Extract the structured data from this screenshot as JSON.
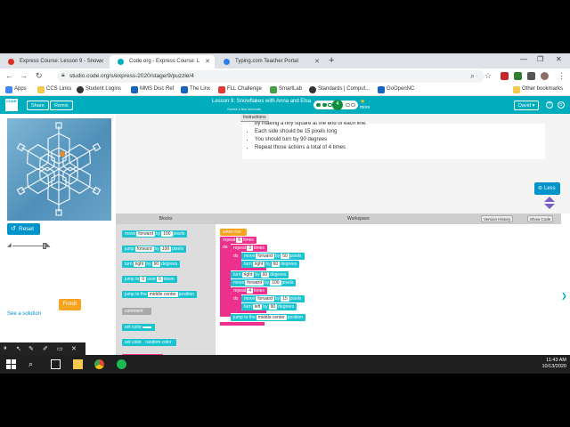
{
  "browser": {
    "tabs": [
      {
        "label": "Express Course: Lesson 9 - Snow",
        "favicon_color": "#d93025"
      },
      {
        "label": "Code.org - Express Course: L",
        "favicon_color": "#00adbc"
      },
      {
        "label": "Typing.com Teacher Portal",
        "favicon_color": "#2f80ed"
      }
    ],
    "url": "studio.code.org/s/express-2020/stage/9/puzzle/4",
    "bookmarks": [
      "Apps",
      "CCS Links",
      "Student Logins",
      "MMS Disc Ref",
      "The Linx",
      "FLL Challenge",
      "SmartLab",
      "Standards | Comput...",
      "GoOpenNC",
      "Other bookmarks"
    ]
  },
  "header": {
    "logo": "CODE",
    "share_label": "Share",
    "remix_label": "Remix",
    "lesson_title": "Lesson 9: Snowflakes with Anna and Elsa",
    "saved_text": "Saved a few seconds",
    "puzzle_number": "4",
    "badge_label": "more",
    "user_label": "David"
  },
  "instructions": {
    "tab_label": "Instructions",
    "cut_line": "by making a tiny square at the end of each line.",
    "items": [
      "Each side should be 15 pixels long",
      "You should turn by 90 degrees",
      "Repeat those actions a total of 4 times"
    ],
    "less_label": "Less"
  },
  "controls": {
    "reset_label": "Reset",
    "finish_label": "Finish",
    "see_solution_label": "See a solution"
  },
  "toolbox": {
    "header": "Blocks",
    "blocks": [
      {
        "pre": "move",
        "field": "forward",
        "mid": "by",
        "val": "100",
        "post": "pixels",
        "color": "teal"
      },
      {
        "pre": "jump",
        "field": "forward",
        "mid": "by",
        "val": "100",
        "post": "pixels",
        "color": "teal"
      },
      {
        "pre": "turn",
        "field": "right",
        "mid": "by",
        "val": "90",
        "post": "degrees",
        "color": "teal"
      },
      {
        "pre": "jump to",
        "field": "0",
        "mid": "over",
        "val": "0",
        "post": "down",
        "color": "teal"
      },
      {
        "pre": "jump to the",
        "field": "middle center",
        "mid": "",
        "val": "",
        "post": "position",
        "color": "teal"
      },
      {
        "pre": "comment",
        "field": "",
        "mid": "",
        "val": "",
        "post": "",
        "color": "grey"
      },
      {
        "pre": "set color",
        "field": "",
        "mid": "",
        "val": "",
        "post": "",
        "color": "teal"
      },
      {
        "pre": "set",
        "field": "color",
        "mid": "random color",
        "val": "",
        "post": "",
        "color": "teal"
      },
      {
        "pre": "repeat",
        "field": "???",
        "mid": "",
        "val": "",
        "post": "times",
        "color": "pink"
      }
    ],
    "do_label": "do"
  },
  "workspace": {
    "header": "Workspace",
    "version_history_label": "Version History",
    "show_code_label": "Show Code",
    "when_run": "when run",
    "outer_repeat": {
      "count": "6",
      "label": "times"
    },
    "inner_repeat": {
      "count": "3",
      "label": "times"
    },
    "do_label": "do",
    "inner_blocks": [
      {
        "pre": "move",
        "field": "forward",
        "mid": "by",
        "val": "50",
        "post": "pixels"
      },
      {
        "pre": "turn",
        "field": "right",
        "mid": "by",
        "val": "60",
        "post": "degrees"
      }
    ],
    "after_blocks": [
      {
        "pre": "turn",
        "field": "right",
        "mid": "by",
        "val": "60",
        "post": "degrees"
      },
      {
        "pre": "move",
        "field": "forward",
        "mid": "by",
        "val": "100",
        "post": "pixels"
      }
    ],
    "square_repeat": {
      "count": "4",
      "label": "times"
    },
    "square_blocks": [
      {
        "pre": "move",
        "field": "forward",
        "mid": "by",
        "val": "15",
        "post": "pixels"
      },
      {
        "pre": "turn",
        "field": "left",
        "mid": "by",
        "val": "90",
        "post": "degrees"
      }
    ],
    "last_block": {
      "pre": "jump to the",
      "field": "middle center",
      "post": "position"
    }
  },
  "taskbar": {
    "time": "11:43 AM",
    "date": "10/13/2020"
  }
}
